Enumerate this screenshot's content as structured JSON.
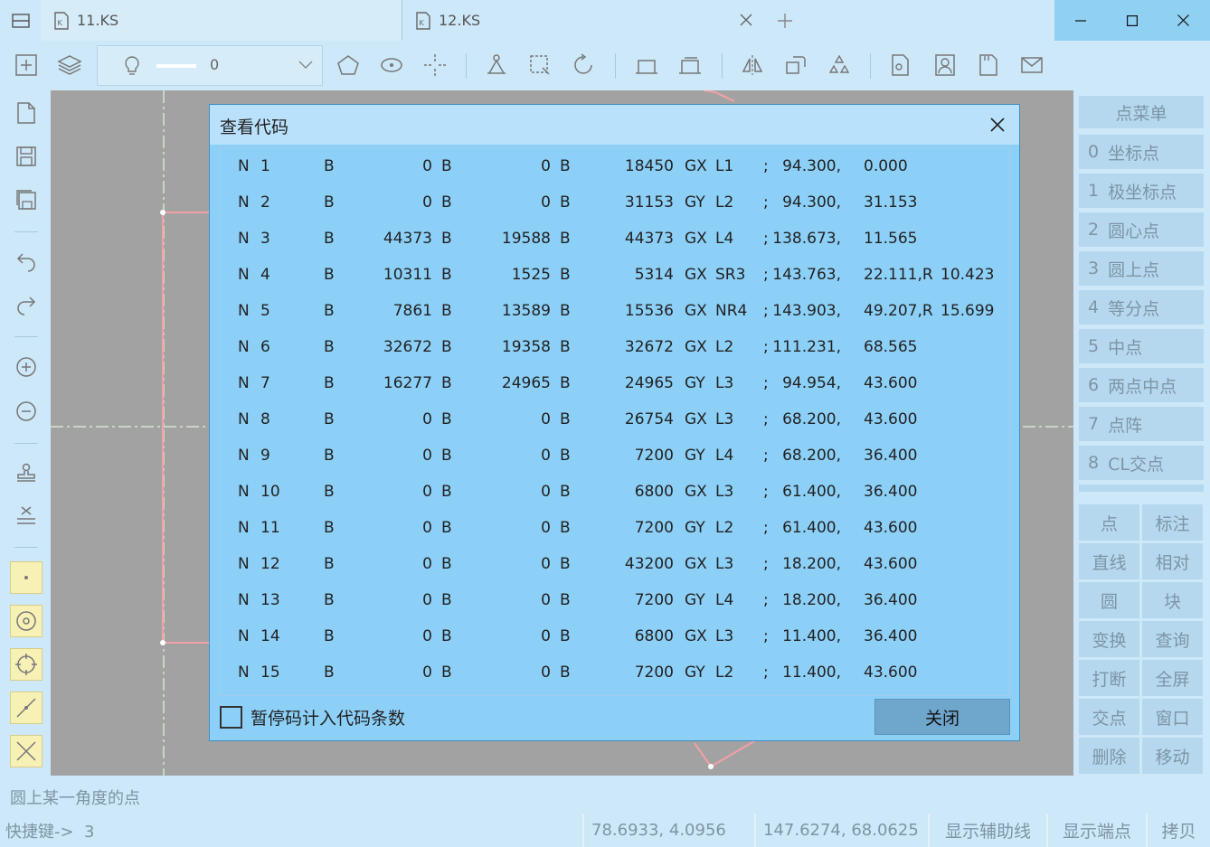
{
  "tabs": [
    {
      "label": "11.KS"
    },
    {
      "label": "12.KS"
    }
  ],
  "toolbar": {
    "line_width_value": "0"
  },
  "dialog": {
    "title": "查看代码",
    "rows": [
      {
        "n": "N",
        "no": "1",
        "b1": "B",
        "v1": "0",
        "b2": "B",
        "v2": "0",
        "b3": "B",
        "v3": "18450",
        "g": "GX",
        "z": "L1",
        "sc": ";",
        "x": "94.300,",
        "y": "0.000",
        "r": ""
      },
      {
        "n": "N",
        "no": "2",
        "b1": "B",
        "v1": "0",
        "b2": "B",
        "v2": "0",
        "b3": "B",
        "v3": "31153",
        "g": "GY",
        "z": "L2",
        "sc": ";",
        "x": "94.300,",
        "y": "31.153",
        "r": ""
      },
      {
        "n": "N",
        "no": "3",
        "b1": "B",
        "v1": "44373",
        "b2": "B",
        "v2": "19588",
        "b3": "B",
        "v3": "44373",
        "g": "GX",
        "z": "L4",
        "sc": ";",
        "x": "138.673,",
        "y": "11.565",
        "r": ""
      },
      {
        "n": "N",
        "no": "4",
        "b1": "B",
        "v1": "10311",
        "b2": "B",
        "v2": "1525",
        "b3": "B",
        "v3": "5314",
        "g": "GX",
        "z": "SR3",
        "sc": ";",
        "x": "143.763,",
        "y": "22.111,R",
        "r": "10.423"
      },
      {
        "n": "N",
        "no": "5",
        "b1": "B",
        "v1": "7861",
        "b2": "B",
        "v2": "13589",
        "b3": "B",
        "v3": "15536",
        "g": "GX",
        "z": "NR4",
        "sc": ";",
        "x": "143.903,",
        "y": "49.207,R",
        "r": "15.699"
      },
      {
        "n": "N",
        "no": "6",
        "b1": "B",
        "v1": "32672",
        "b2": "B",
        "v2": "19358",
        "b3": "B",
        "v3": "32672",
        "g": "GX",
        "z": "L2",
        "sc": ";",
        "x": "111.231,",
        "y": "68.565",
        "r": ""
      },
      {
        "n": "N",
        "no": "7",
        "b1": "B",
        "v1": "16277",
        "b2": "B",
        "v2": "24965",
        "b3": "B",
        "v3": "24965",
        "g": "GY",
        "z": "L3",
        "sc": ";",
        "x": "94.954,",
        "y": "43.600",
        "r": ""
      },
      {
        "n": "N",
        "no": "8",
        "b1": "B",
        "v1": "0",
        "b2": "B",
        "v2": "0",
        "b3": "B",
        "v3": "26754",
        "g": "GX",
        "z": "L3",
        "sc": ";",
        "x": "68.200,",
        "y": "43.600",
        "r": ""
      },
      {
        "n": "N",
        "no": "9",
        "b1": "B",
        "v1": "0",
        "b2": "B",
        "v2": "0",
        "b3": "B",
        "v3": "7200",
        "g": "GY",
        "z": "L4",
        "sc": ";",
        "x": "68.200,",
        "y": "36.400",
        "r": ""
      },
      {
        "n": "N",
        "no": "10",
        "b1": "B",
        "v1": "0",
        "b2": "B",
        "v2": "0",
        "b3": "B",
        "v3": "6800",
        "g": "GX",
        "z": "L3",
        "sc": ";",
        "x": "61.400,",
        "y": "36.400",
        "r": ""
      },
      {
        "n": "N",
        "no": "11",
        "b1": "B",
        "v1": "0",
        "b2": "B",
        "v2": "0",
        "b3": "B",
        "v3": "7200",
        "g": "GY",
        "z": "L2",
        "sc": ";",
        "x": "61.400,",
        "y": "43.600",
        "r": ""
      },
      {
        "n": "N",
        "no": "12",
        "b1": "B",
        "v1": "0",
        "b2": "B",
        "v2": "0",
        "b3": "B",
        "v3": "43200",
        "g": "GX",
        "z": "L3",
        "sc": ";",
        "x": "18.200,",
        "y": "43.600",
        "r": ""
      },
      {
        "n": "N",
        "no": "13",
        "b1": "B",
        "v1": "0",
        "b2": "B",
        "v2": "0",
        "b3": "B",
        "v3": "7200",
        "g": "GY",
        "z": "L4",
        "sc": ";",
        "x": "18.200,",
        "y": "36.400",
        "r": ""
      },
      {
        "n": "N",
        "no": "14",
        "b1": "B",
        "v1": "0",
        "b2": "B",
        "v2": "0",
        "b3": "B",
        "v3": "6800",
        "g": "GX",
        "z": "L3",
        "sc": ";",
        "x": "11.400,",
        "y": "36.400",
        "r": ""
      },
      {
        "n": "N",
        "no": "15",
        "b1": "B",
        "v1": "0",
        "b2": "B",
        "v2": "0",
        "b3": "B",
        "v3": "7200",
        "g": "GY",
        "z": "L2",
        "sc": ";",
        "x": "11.400,",
        "y": "43.600",
        "r": ""
      }
    ],
    "checkbox_label": "暂停码计入代码条数",
    "checkbox_checked": false,
    "close_label": "关闭"
  },
  "point_menu": {
    "title": "点菜单",
    "items": [
      {
        "num": "0",
        "label": "坐标点"
      },
      {
        "num": "1",
        "label": "极坐标点"
      },
      {
        "num": "2",
        "label": "圆心点"
      },
      {
        "num": "3",
        "label": "圆上点"
      },
      {
        "num": "4",
        "label": "等分点"
      },
      {
        "num": "5",
        "label": "中点"
      },
      {
        "num": "6",
        "label": "两点中点"
      },
      {
        "num": "7",
        "label": "点阵"
      },
      {
        "num": "8",
        "label": "CL交点"
      }
    ]
  },
  "func_buttons": [
    "点",
    "标注",
    "直线",
    "相对",
    "圆",
    "块",
    "变换",
    "查询",
    "打断",
    "全屏",
    "交点",
    "窗口",
    "删除",
    "移动"
  ],
  "status": {
    "hint": "圆上某一角度的点",
    "shortcut_label": "快捷键->",
    "shortcut_value": "3",
    "coord1": "78.6933, 4.0956",
    "coord2": "147.6274, 68.0625",
    "btn_aux": "显示辅助线",
    "btn_endpoint": "显示端点",
    "btn_copy": "拷贝"
  },
  "colors": {
    "accent": "#8cd0f8",
    "chrome": "#cde8f8",
    "canvas": "#a2a2a2",
    "profile": "#f4a0a8"
  }
}
